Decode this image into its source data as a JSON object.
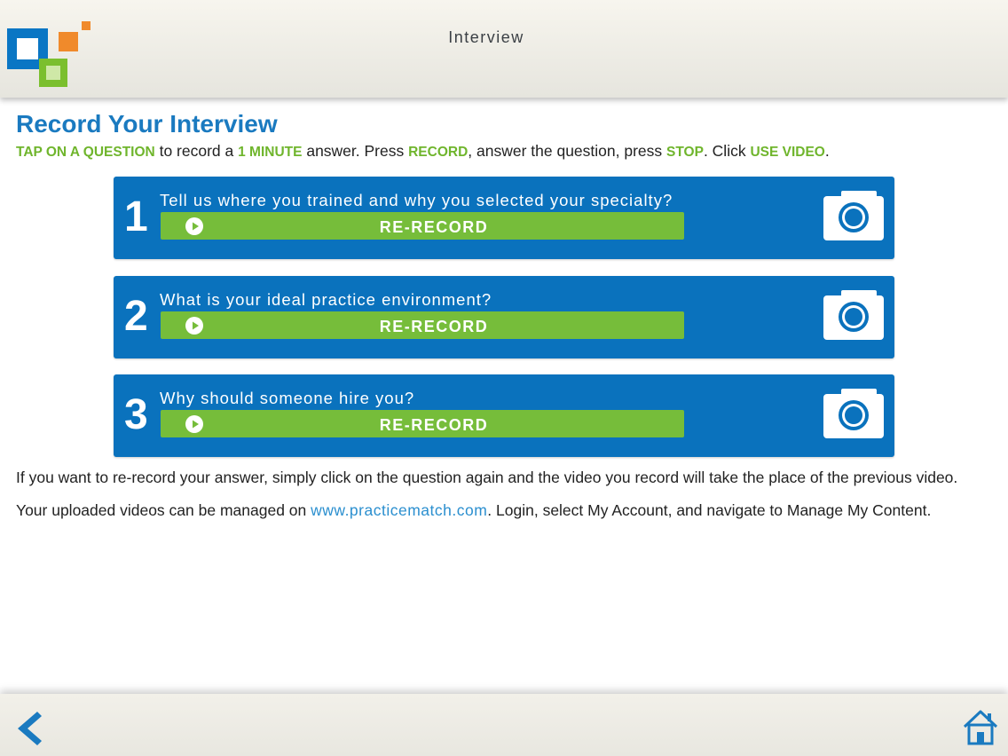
{
  "header": {
    "title": "Interview"
  },
  "page": {
    "heading": "Record Your Interview",
    "instructions": {
      "hl1": "TAP ON A QUESTION",
      "t1": " to record a ",
      "hl2": "1 MINUTE",
      "t2": " answer. Press ",
      "hl3": "RECORD",
      "t3": ", answer the question, press ",
      "hl4": "STOP",
      "t4": ". Click ",
      "hl5": "USE VIDEO",
      "t5": "."
    },
    "questions": [
      {
        "number": "1",
        "text": "Tell us where you trained and why you selected your specialty?",
        "action_label": "RE-RECORD"
      },
      {
        "number": "2",
        "text": "What is your ideal practice environment?",
        "action_label": "RE-RECORD"
      },
      {
        "number": "3",
        "text": "Why should someone hire you?",
        "action_label": "RE-RECORD"
      }
    ],
    "note1": "If you want to re-record your answer, simply click on the question again and the video you record will take the place of the previous video.",
    "note2_before": "Your uploaded videos can be managed on ",
    "note2_link": "www.practicematch.com",
    "note2_after": ". Login, select My Account, and navigate to Manage My Content."
  },
  "footer": {
    "back_icon": "chevron-left-icon",
    "home_icon": "home-icon"
  },
  "colors": {
    "accent_blue": "#0a72bd",
    "accent_green": "#76bd3a",
    "highlight_green": "#6fb52c",
    "link": "#2b8fcf"
  }
}
